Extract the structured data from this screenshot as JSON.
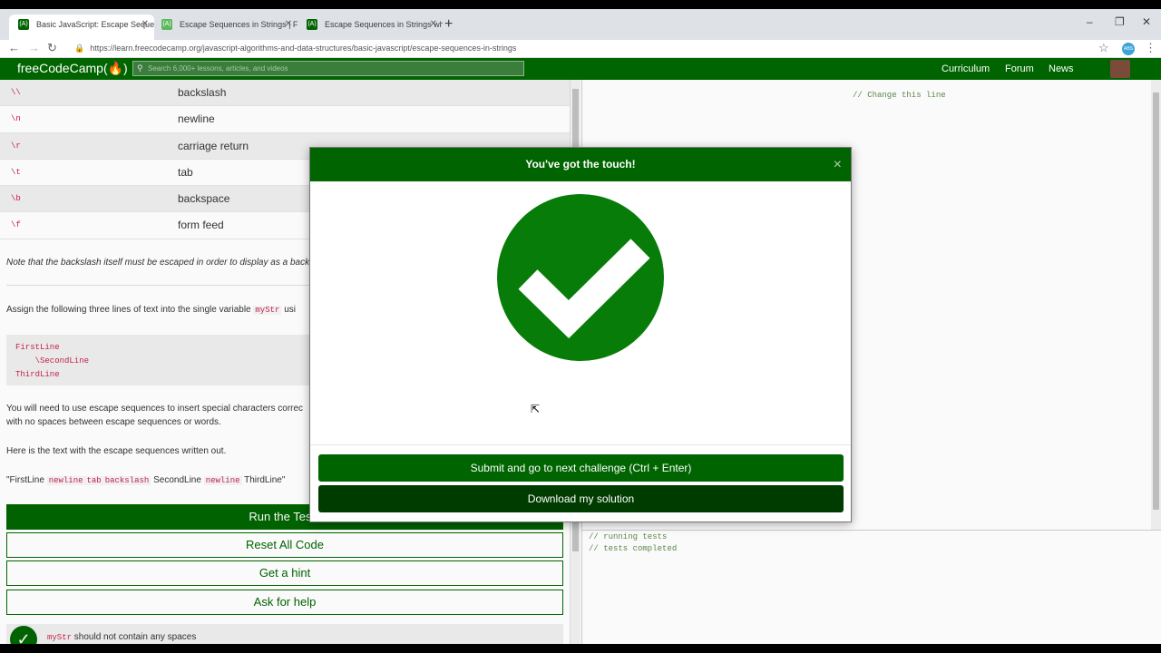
{
  "browser": {
    "tabs": [
      {
        "label": "Basic JavaScript: Escape Sequences in Strings"
      },
      {
        "label": "Escape Sequences in Strings | Free"
      },
      {
        "label": "Escape Sequences in Strings what"
      }
    ],
    "url": "https://learn.freecodecamp.org/javascript-algorithms-and-data-structures/basic-javascript/escape-sequences-in-strings",
    "ext_badge": "ABS"
  },
  "site": {
    "logo": "freeCodeCamp(🔥)",
    "search_placeholder": "Search 6,000+ lessons, articles, and videos",
    "nav": [
      "Curriculum",
      "Forum",
      "News"
    ]
  },
  "lesson": {
    "escape_table": [
      {
        "code": "\\\\",
        "desc": "backslash"
      },
      {
        "code": "\\n",
        "desc": "newline"
      },
      {
        "code": "\\r",
        "desc": "carriage return"
      },
      {
        "code": "\\t",
        "desc": "tab"
      },
      {
        "code": "\\b",
        "desc": "backspace"
      },
      {
        "code": "\\f",
        "desc": "form feed"
      }
    ],
    "note": "Note that the backslash itself must be escaped in order to display as a backsla",
    "assign_prefix": "Assign the following three lines of text into the single variable",
    "assign_var": "myStr",
    "assign_suffix": "usi",
    "pre_text": "FirstLine\n    \\SecondLine\nThirdLine",
    "escape_para_1": "You will need to use escape sequences to insert special characters correc",
    "escape_para_2": "with no spaces between escape sequences or words.",
    "here_text": "Here is the text with the escape sequences written out.",
    "example": {
      "q1": "\"FirstLine",
      "c1": "newline",
      "c2": "tab",
      "c3": "backslash",
      "t2": "SecondLine",
      "c4": "newline",
      "t3": "ThirdLine\""
    },
    "buttons": {
      "run": "Run the Tests",
      "reset": "Reset All Code",
      "hint": "Get a hint",
      "help": "Ask for help"
    },
    "test_result": {
      "code": "myStr",
      "text": "should not contain any spaces"
    }
  },
  "editor": {
    "line": "// Change this line"
  },
  "output": {
    "lines": [
      "// running tests",
      "// tests completed"
    ]
  },
  "modal": {
    "title": "You've got the touch!",
    "close": "×",
    "submit_label": "Submit and go to next challenge (Ctrl + Enter)",
    "download_label": "Download my solution",
    "accent": "#006400"
  },
  "window_controls": [
    "–",
    "❐",
    "✕"
  ]
}
